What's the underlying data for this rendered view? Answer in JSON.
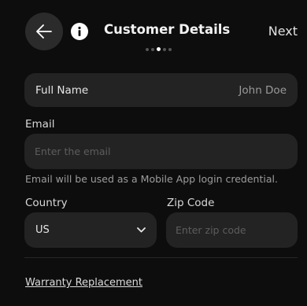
{
  "header": {
    "back_icon": "arrow-left-icon",
    "info_icon": "info-icon",
    "title": "Customer Details",
    "next_label": "Next",
    "steps_total": 5,
    "steps_active_index": 2
  },
  "form": {
    "full_name": {
      "label": "Full Name",
      "value": "John Doe"
    },
    "email": {
      "label": "Email",
      "placeholder": "Enter the email",
      "value": "",
      "helper": "Email will be used as a Mobile App login credential."
    },
    "country": {
      "label": "Country",
      "value": "US",
      "icon": "chevron-down-icon"
    },
    "zip_code": {
      "label": "Zip Code",
      "placeholder": "Enter zip code",
      "value": ""
    },
    "warranty_link": "Warranty Replacement"
  },
  "colors": {
    "background": "#0d0d0d",
    "field_background": "#232323",
    "back_button_background": "#2b2b2b",
    "text_primary": "#ffffff",
    "text_secondary": "#9c9c9c",
    "placeholder": "#5d5d5d"
  }
}
